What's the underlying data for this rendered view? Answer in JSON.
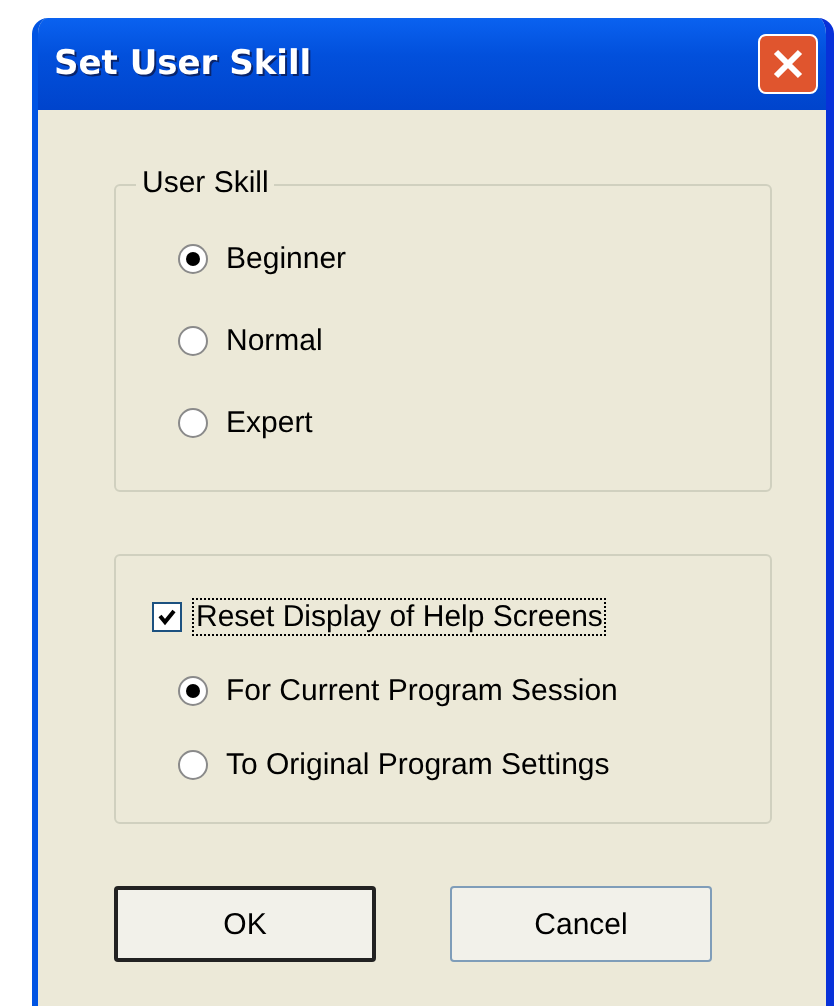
{
  "window": {
    "title": "Set User Skill"
  },
  "user_skill": {
    "legend": "User Skill",
    "options": [
      {
        "label": "Beginner",
        "selected": true
      },
      {
        "label": "Normal",
        "selected": false
      },
      {
        "label": "Expert",
        "selected": false
      }
    ]
  },
  "help_reset": {
    "label": "Reset Display of Help Screens",
    "checked": true,
    "options": [
      {
        "label": "For Current Program Session",
        "selected": true
      },
      {
        "label": "To Original Program Settings",
        "selected": false
      }
    ]
  },
  "buttons": [
    {
      "label": "OK",
      "default": true
    },
    {
      "label": "Cancel",
      "default": false
    }
  ]
}
